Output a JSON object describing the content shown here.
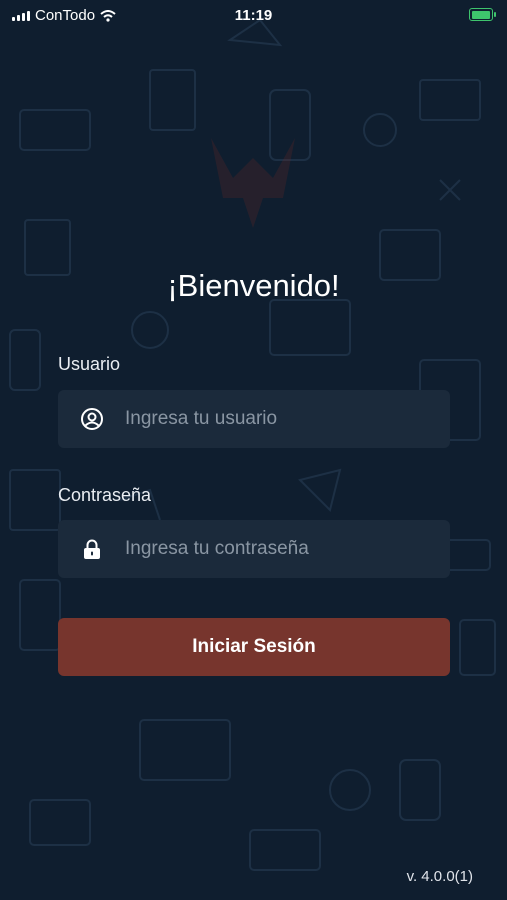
{
  "status_bar": {
    "carrier": "ConTodo",
    "time": "11:19",
    "icons": [
      "signal-icon",
      "wifi-icon",
      "battery-icon"
    ]
  },
  "welcome_title": "¡Bienvenido!",
  "username": {
    "label": "Usuario",
    "placeholder": "Ingresa tu usuario",
    "value": "",
    "icon": "user-circle-icon"
  },
  "password": {
    "label": "Contraseña",
    "placeholder": "Ingresa tu contraseña",
    "value": "",
    "icon": "lock-icon"
  },
  "login_button": {
    "label": "Iniciar Sesión"
  },
  "version": "v. 4.0.0(1)",
  "colors": {
    "background": "#0f1e2f",
    "input_background": "#1b2a3b",
    "button": "#77352d",
    "placeholder": "#8a96a3"
  }
}
